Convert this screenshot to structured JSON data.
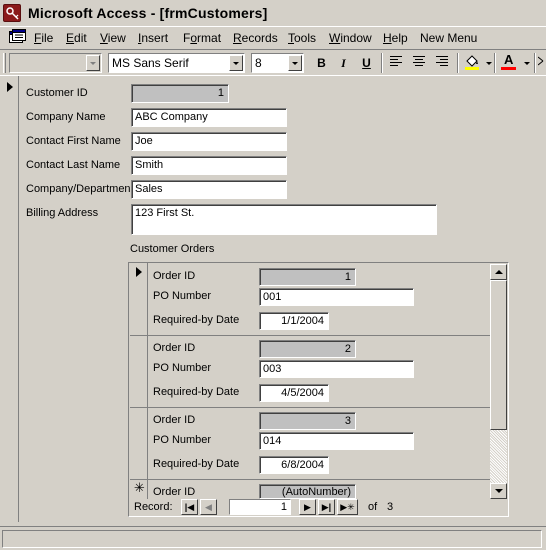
{
  "window": {
    "title": "Microsoft Access - [frmCustomers]"
  },
  "menu": {
    "items": [
      {
        "label": "File",
        "u": "F",
        "rest": "ile"
      },
      {
        "label": "Edit",
        "u": "E",
        "rest": "dit"
      },
      {
        "label": "View",
        "u": "V",
        "rest": "iew"
      },
      {
        "label": "Insert",
        "u": "I",
        "rest": "nsert"
      },
      {
        "label": "Format",
        "pre": "F",
        "u": "o",
        "rest": "rmat"
      },
      {
        "label": "Records",
        "u": "R",
        "rest": "ecords"
      },
      {
        "label": "Tools",
        "u": "T",
        "rest": "ools"
      },
      {
        "label": "Window",
        "u": "W",
        "rest": "indow"
      },
      {
        "label": "Help",
        "u": "H",
        "rest": "elp"
      },
      {
        "label": "New Menu",
        "u": "",
        "rest": "New Menu"
      }
    ]
  },
  "toolbar": {
    "object_combo": "",
    "font_name": "MS Sans Serif",
    "font_size": "8",
    "bold": "B",
    "italic": "I",
    "underline": "U",
    "font_color_glyph": "A",
    "fill_color": "#ffff00",
    "font_color": "#ff0000"
  },
  "customer": {
    "id_label": "Customer ID",
    "id_value": "1",
    "company_label": "Company Name",
    "company_value": "ABC Company",
    "first_label": "Contact First Name",
    "first_value": "Joe",
    "last_label": "Contact Last Name",
    "last_value": "Smith",
    "dept_label": "Company/Departmen",
    "dept_value": "Sales",
    "billing_label": "Billing Address",
    "billing_value": "123 First St."
  },
  "orders": {
    "caption": "Customer Orders",
    "labels": {
      "order_id": "Order ID",
      "po": "PO Number",
      "required": "Required-by Date"
    },
    "records": [
      {
        "order_id": "1",
        "po": "001",
        "required": "1/1/2004"
      },
      {
        "order_id": "2",
        "po": "003",
        "required": "4/5/2004"
      },
      {
        "order_id": "3",
        "po": "014",
        "required": "6/8/2004"
      }
    ],
    "new_record": {
      "order_id": "(AutoNumber)"
    },
    "nav": {
      "record_label": "Record:",
      "current": "1",
      "of_label": "of",
      "total": "3"
    }
  }
}
